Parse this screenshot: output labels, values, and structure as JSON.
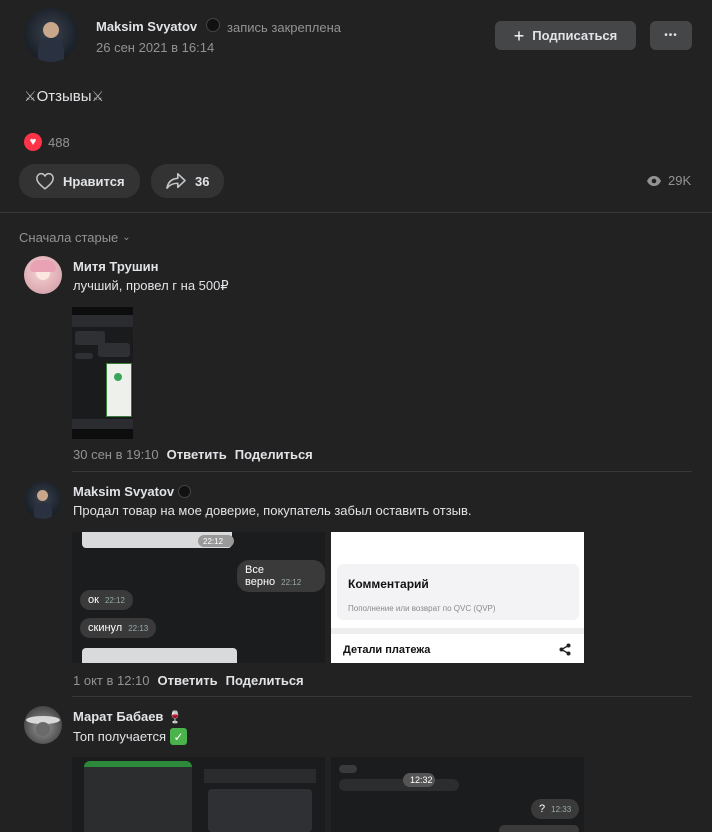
{
  "post": {
    "author": "Maksim Svyatov",
    "pinned_label": "запись закреплена",
    "date": "26 сен 2021 в 16:14",
    "subscribe_label": "Подписаться",
    "more_label": "•••",
    "text": "Отзывы",
    "reactions_count": "488",
    "like_label": "Нравится",
    "shares_count": "36",
    "views_count": "29K"
  },
  "comments_sort_label": "Сначала старые",
  "comments": [
    {
      "author": "Митя Трушин",
      "text": "лучший, провел г на 500₽",
      "date": "30 сен в 19:10",
      "reply_label": "Ответить",
      "share_label": "Поделиться"
    },
    {
      "author": "Maksim Svyatov",
      "text": "Продал товар на мое доверие, покупатель забыл оставить отзыв.",
      "date": "1 окт в 12:10",
      "reply_label": "Ответить",
      "share_label": "Поделиться",
      "chat": {
        "b1_text": "Все верно",
        "b1_time": "22:12",
        "b2_text": "ок",
        "b2_time": "22:12",
        "b3_text": "скинул",
        "b3_time": "22:13",
        "top_time": "22:12"
      },
      "receipt": {
        "comment_title": "Комментарий",
        "comment_value": "Пополнение или возврат по QVC (QVP)",
        "details_title": "Детали платежа"
      }
    },
    {
      "author": "Марат Бабаев",
      "text": "Топ получается",
      "chat": {
        "time1": "12:32",
        "q": "?",
        "q_time": "12:33"
      }
    }
  ],
  "colors": {
    "background": "#222222",
    "button": "#333333",
    "text": "#e1e3e6",
    "muted": "#939393",
    "reaction_red": "#ff3347",
    "check_green": "#4bb34b"
  }
}
